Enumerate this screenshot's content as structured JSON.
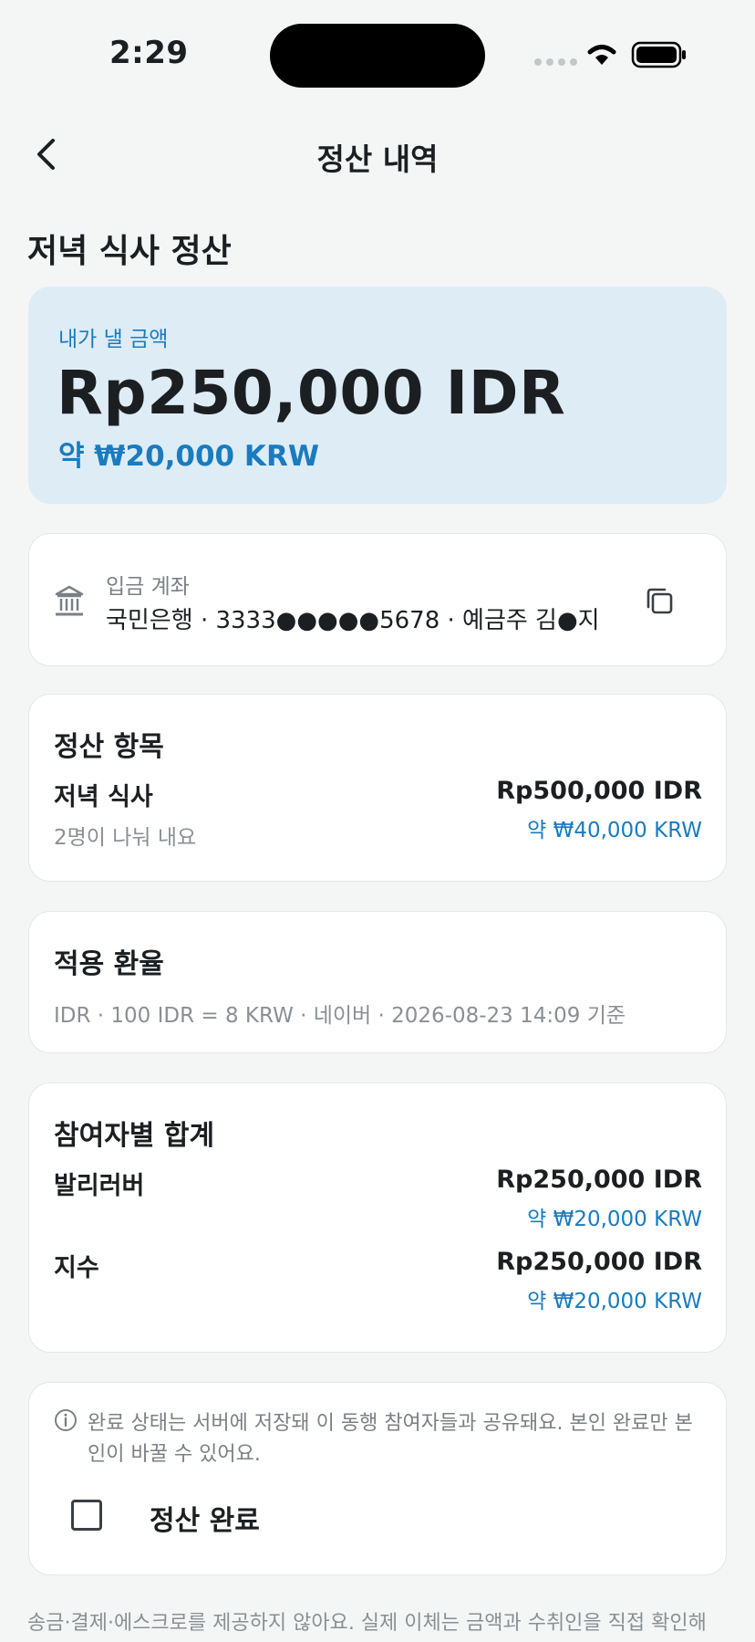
{
  "status_bar": {
    "time": "2:29"
  },
  "nav": {
    "title": "정산 내역"
  },
  "page_title": "저녁 식사 정산",
  "my_amount": {
    "label": "내가 낼 금액",
    "amount": "Rp250,000 IDR",
    "converted": "약 ₩20,000 KRW"
  },
  "account": {
    "label": "입금 계좌",
    "value": "국민은행 · 3333●●●●●5678 · 예금주 김●지"
  },
  "items_section": {
    "title": "정산 항목",
    "items": [
      {
        "name": "저녁 식사",
        "note": "2명이 나눠 내요",
        "amount": "Rp500,000 IDR",
        "converted": "약 ₩40,000 KRW"
      }
    ]
  },
  "rate_section": {
    "title": "적용 환율",
    "detail": "IDR · 100 IDR = 8 KRW · 네이버 · 2026-08-23 14:09 기준"
  },
  "participants_section": {
    "title": "참여자별 합계",
    "participants": [
      {
        "name": "발리러버",
        "amount": "Rp250,000 IDR",
        "converted": "약 ₩20,000 KRW"
      },
      {
        "name": "지수",
        "amount": "Rp250,000 IDR",
        "converted": "약 ₩20,000 KRW"
      }
    ]
  },
  "completion": {
    "info": "완료 상태는 서버에 저장돼 이 동행 참여자들과 공유돼요. 본인 완료만 본인이 바꿀 수 있어요.",
    "checkbox_label": "정산 완료",
    "checked": false
  },
  "footer_note": "송금·결제·에스크로를 제공하지 않아요. 실제 이체는 금액과 수취인을 직접 확인해",
  "icons": {
    "back": "chevron-left-icon",
    "bank": "bank-icon",
    "copy": "copy-icon",
    "info": "info-icon"
  },
  "colors": {
    "accent": "#1a7bbf",
    "hero_bg": "#deecf6",
    "page_bg": "#f4f6f6"
  }
}
